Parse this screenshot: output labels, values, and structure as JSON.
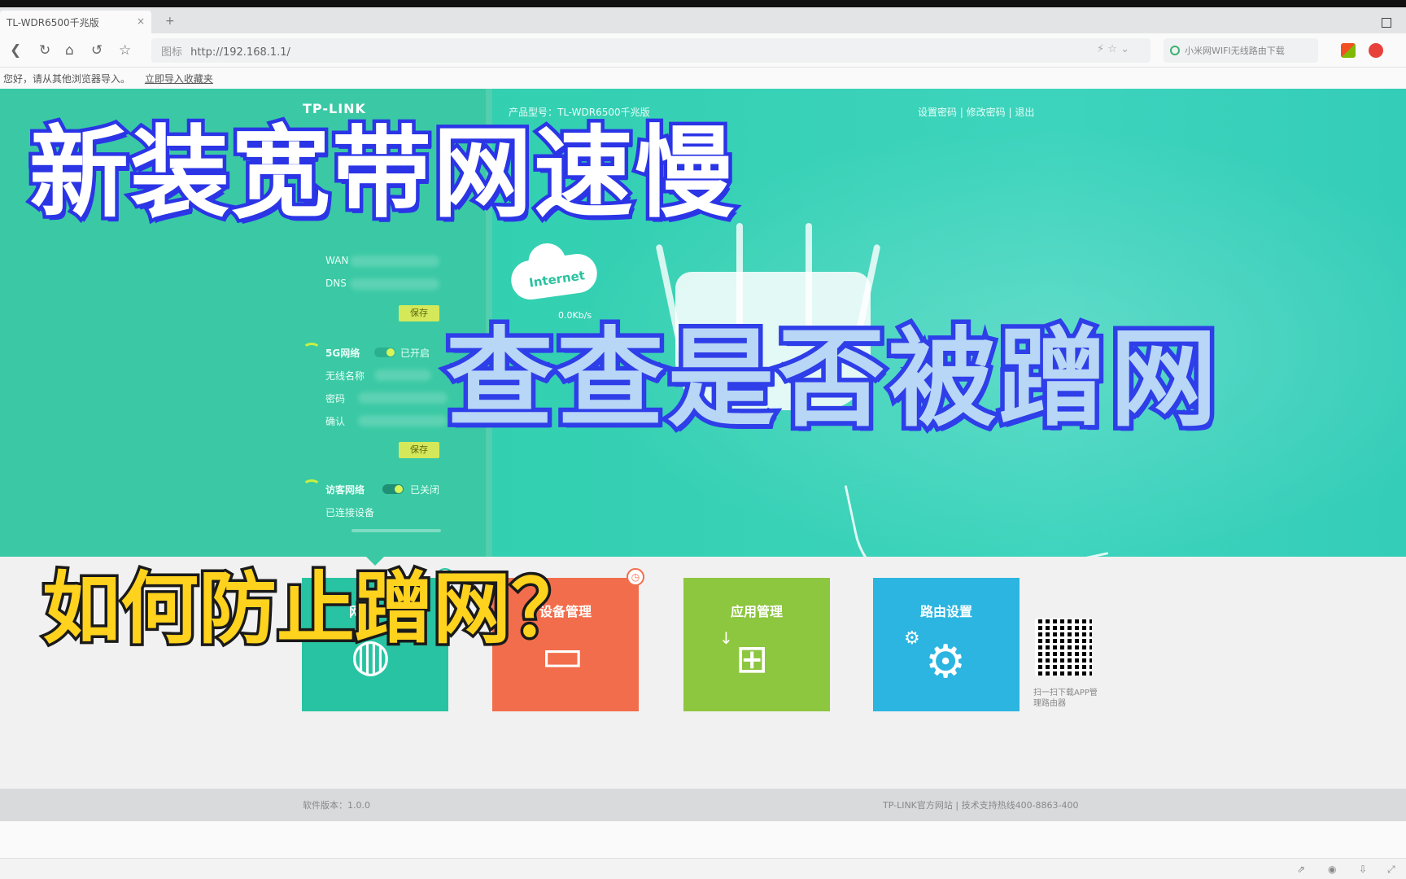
{
  "browser": {
    "tab_title": "TL-WDR6500千兆版",
    "tab_close": "×",
    "tab_new": "+",
    "address": "http://192.168.1.1/",
    "address_prefix": "图标",
    "search_placeholder": "小米网WIFI无线路由下载",
    "infobar_text": "您好，请从其他浏览器导入。",
    "infobar_link": "立即导入收藏夹"
  },
  "router": {
    "brand": "TP-LINK",
    "model": "产品型号：TL-WDR6500千兆版",
    "toplinks": "设置密码 | 修改密码 | 退出",
    "sidebar": {
      "wan_label": "WAN",
      "dns_label": "DNS",
      "save_btn": "保存",
      "wifi5g_label": "5G网络",
      "wifi5g_status": "已开启",
      "wifi5g_name": "无线名称",
      "wifi5g_pwd": "密码",
      "wifi5g_pwd2": "确认",
      "save_btn2": "保存",
      "guest_label": "访客网络",
      "guest_status": "已关闭",
      "guest_connected": "已连接设备"
    },
    "cloud_text": "Internet",
    "cloud_sub": "0.0Kb/s",
    "tiles": [
      {
        "label": "网络状态",
        "color": "#28c3a2",
        "icon": "globe-icon"
      },
      {
        "label": "设备管理",
        "color": "#f26d4b",
        "icon": "laptop-icon"
      },
      {
        "label": "应用管理",
        "color": "#8dc63f",
        "icon": "apps-icon"
      },
      {
        "label": "路由设置",
        "color": "#2bb5e0",
        "icon": "gear-icon"
      }
    ],
    "qr_text": "扫一扫下载APP管理路由器",
    "footer_left": "软件版本：1.0.0",
    "footer_right": "TP-LINK官方网站 | 技术支持热线400-8863-400"
  },
  "overlay": {
    "title_line1": "新装宽带网速慢",
    "title_line2": "查查是否被蹭网",
    "question": "如何防止蹭网？"
  },
  "colors": {
    "hero_teal": "#34d0b2",
    "overlay_blue": "#2b35e6",
    "overlay_yellow": "#ffd21e"
  }
}
